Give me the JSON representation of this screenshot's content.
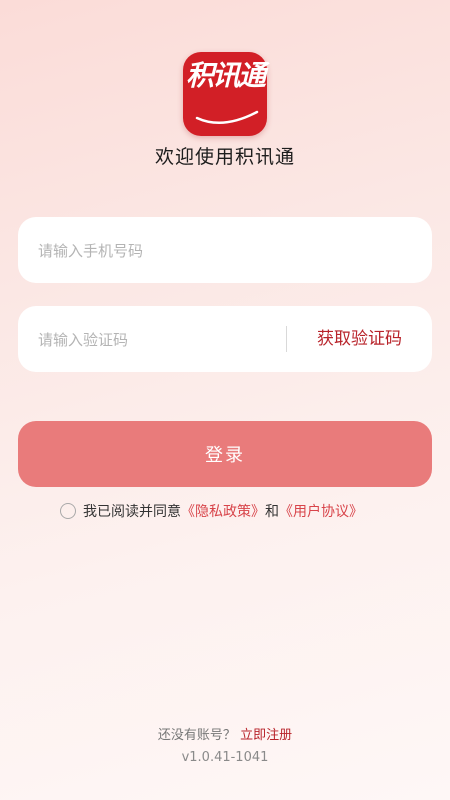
{
  "app": {
    "logo_text": "积讯通",
    "welcome": "欢迎使用积讯通"
  },
  "phone": {
    "placeholder": "请输入手机号码",
    "value": ""
  },
  "code": {
    "placeholder": "请输入验证码",
    "value": "",
    "get_code_label": "获取验证码"
  },
  "login": {
    "label": "登录"
  },
  "agreement": {
    "checked": false,
    "prefix": "我已阅读并同意",
    "privacy_link": "《隐私政策》",
    "conjunction": "和",
    "user_link": "《用户协议》"
  },
  "footer": {
    "no_account": "还没有账号？",
    "register_link": "立即注册",
    "version": "v1.0.41-1041"
  },
  "colors": {
    "brand": "#d21f26",
    "accent_text": "#b8232a",
    "button_bg": "#e97b7b",
    "link": "#d8444a"
  },
  "icons": {
    "logo": "brand-logo",
    "checkbox": "radio-circle-icon"
  }
}
